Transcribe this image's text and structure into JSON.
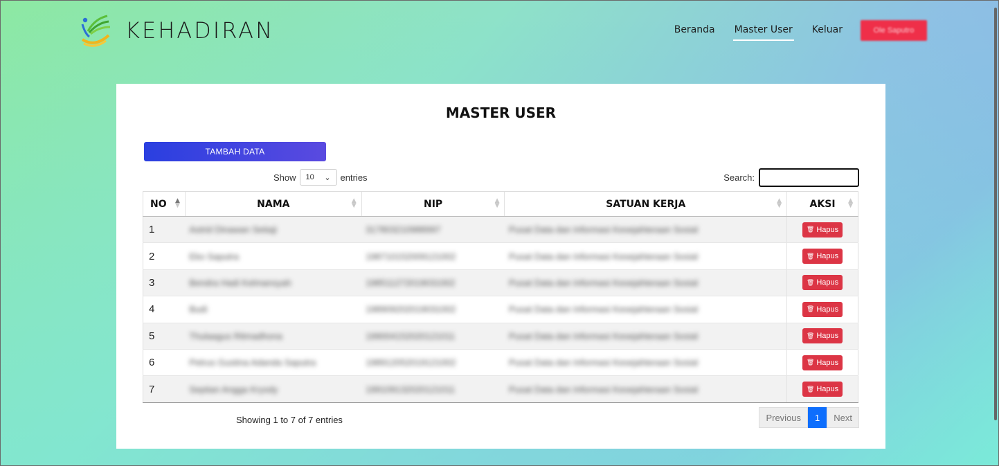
{
  "brand": {
    "name": "KEHADIRAN"
  },
  "nav": {
    "items": [
      {
        "label": "Beranda",
        "active": false
      },
      {
        "label": "Master User",
        "active": true
      },
      {
        "label": "Keluar",
        "active": false
      }
    ],
    "user_label": "Ole Saputro"
  },
  "page": {
    "title": "MASTER USER",
    "add_button": "TAMBAH DATA"
  },
  "table_controls": {
    "show_label": "Show",
    "entries_label": "entries",
    "page_length": "10",
    "search_label": "Search:"
  },
  "table": {
    "headers": [
      "NO",
      "NAMA",
      "NIP",
      "SATUAN KERJA",
      "AKSI"
    ],
    "action_label": "Hapus",
    "rows": [
      {
        "no": "1",
        "nama": "Astrid Dinawan Setiaji",
        "nip": "317803210988997",
        "satker": "Pusat Data dan Informasi Kesejahteraan Sosial"
      },
      {
        "no": "2",
        "nama": "Eko Saputra",
        "nip": "198710152009121002",
        "satker": "Pusat Data dan Informasi Kesejahteraan Sosial"
      },
      {
        "no": "3",
        "nama": "Bendra Hadi Kelmansyah",
        "nip": "198511272019031002",
        "satker": "Pusat Data dan Informasi Kesejahteraan Sosial"
      },
      {
        "no": "4",
        "nama": "Budi",
        "nip": "198909202019031002",
        "satker": "Pusat Data dan Informasi Kesejahteraan Sosial"
      },
      {
        "no": "5",
        "nama": "Thulaagus Ritmadhona",
        "nip": "199004152020121011",
        "satker": "Pusat Data dan Informasi Kesejahteraan Sosial"
      },
      {
        "no": "6",
        "nama": "Petrus Gustina Adanda Saputra",
        "nip": "198912052019121002",
        "satker": "Pusat Data dan Informasi Kesejahteraan Sosial"
      },
      {
        "no": "7",
        "nama": "Septian Angga Krysdy",
        "nip": "199109132020121011",
        "satker": "Pusat Data dan Informasi Kesejahteraan Sosial"
      }
    ]
  },
  "footer": {
    "info": "Showing 1 to 7 of 7 entries",
    "pagination": {
      "previous": "Previous",
      "current": "1",
      "next": "Next"
    }
  },
  "colors": {
    "accent_blue": "#0d6efd",
    "button_indigo": "#3b44e0",
    "danger": "#dc3545",
    "user_pill": "#ef2f49"
  }
}
